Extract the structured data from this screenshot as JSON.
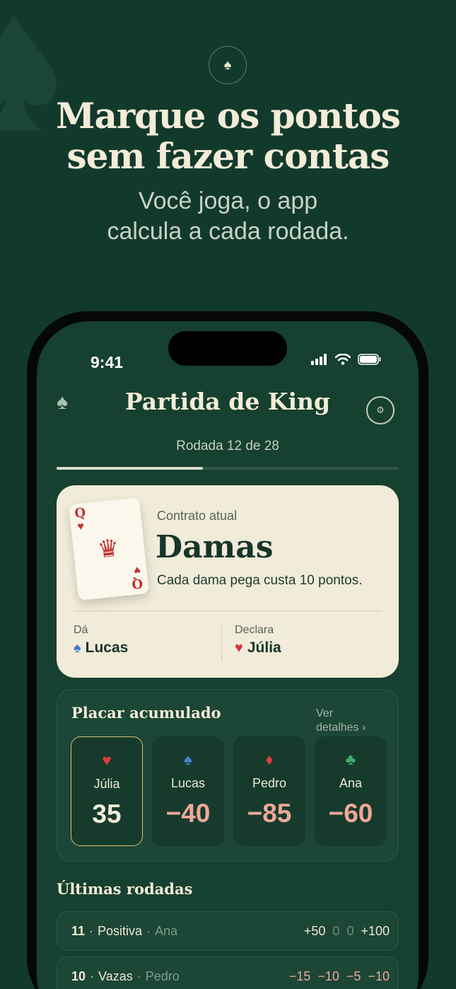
{
  "hero": {
    "badge_icon": "spade-icon",
    "title_line1": "Marque os pontos",
    "title_line2": "sem fazer contas",
    "subtitle_line1": "Você joga, o app",
    "subtitle_line2": "calcula a cada rodada."
  },
  "status": {
    "time": "9:41"
  },
  "header": {
    "title": "Partida de King",
    "left_icon": "spade-icon",
    "right_icon": "gear-icon"
  },
  "round": {
    "label": "Rodada 12 de 28",
    "current": 12,
    "total": 28
  },
  "contract": {
    "label": "Contrato atual",
    "name": "Damas",
    "description": "Cada dama pega custa 10 pontos.",
    "card_rank": "Q",
    "card_suit": "♥",
    "dealer_label": "Dá",
    "dealer_name": "Lucas",
    "dealer_suit": "♠",
    "declarer_label": "Declara",
    "declarer_name": "Júlia",
    "declarer_suit": "♥"
  },
  "scoreboard": {
    "title": "Placar acumulado",
    "link_line1": "Ver",
    "link_line2": "detalhes ›",
    "players": [
      {
        "name": "Júlia",
        "suit": "♥",
        "suit_color": "#e0403c",
        "score": "35",
        "score_color": "#f3ecd8",
        "active": true
      },
      {
        "name": "Lucas",
        "suit": "♠",
        "suit_color": "#4d82d6",
        "score": "−40",
        "score_color": "#eea898",
        "active": false
      },
      {
        "name": "Pedro",
        "suit": "♦",
        "suit_color": "#e0403c",
        "score": "−85",
        "score_color": "#eea898",
        "active": false
      },
      {
        "name": "Ana",
        "suit": "♣",
        "suit_color": "#3fae6c",
        "score": "−60",
        "score_color": "#eea898",
        "active": false
      }
    ]
  },
  "recent": {
    "title": "Últimas rodadas",
    "rows": [
      {
        "number": "11",
        "game": "Positiva",
        "player": "Ana",
        "values": [
          {
            "text": "+50",
            "color": "#eee7d4"
          },
          {
            "text": "0",
            "color": "#6f8c7e"
          },
          {
            "text": "0",
            "color": "#6f8c7e"
          },
          {
            "text": "+100",
            "color": "#eee7d4"
          }
        ]
      },
      {
        "number": "10",
        "game": "Vazas",
        "player": "Pedro",
        "values": [
          {
            "text": "−15",
            "color": "#eea898"
          },
          {
            "text": "−10",
            "color": "#eea898"
          },
          {
            "text": "−5",
            "color": "#eea898"
          },
          {
            "text": "−10",
            "color": "#eea898"
          }
        ]
      }
    ]
  }
}
